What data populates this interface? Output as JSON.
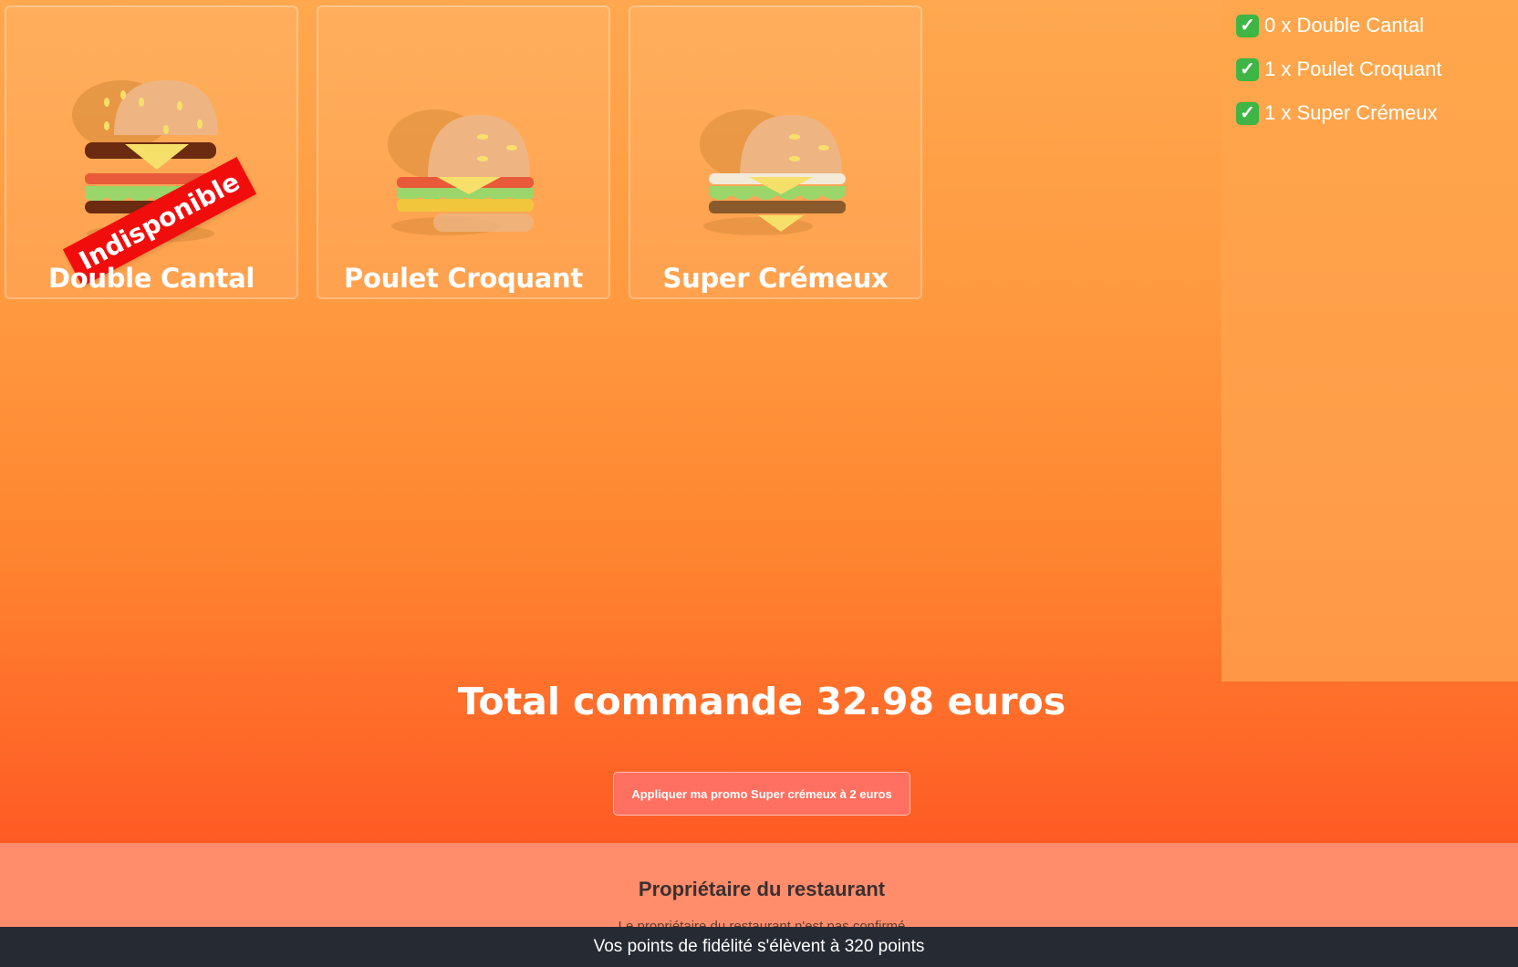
{
  "products": [
    {
      "name": "Double Cantal",
      "badge": "Indisponible",
      "icon": "double-burger-icon"
    },
    {
      "name": "Poulet Croquant",
      "icon": "chicken-burger-icon"
    },
    {
      "name": "Super Crémeux",
      "icon": "creamy-burger-icon"
    }
  ],
  "order": {
    "lines": [
      {
        "icon": "check-mark-icon",
        "text": "0 x Double Cantal"
      },
      {
        "icon": "check-mark-icon",
        "text": "1 x Poulet Croquant"
      },
      {
        "icon": "check-mark-icon",
        "text": "1 x Super Crémeux"
      }
    ]
  },
  "total": "Total commande 32.98 euros",
  "promo_button": "Appliquer ma promo Super crémeux à 2 euros",
  "owner": {
    "title": "Propriétaire du restaurant",
    "subtitle": "Le propriétaire du restaurant n'est pas confirmé"
  },
  "footer": "Vos points de fidélité s'élèvent à 320 points",
  "colors": {
    "background_top": "#ffa84f",
    "background_bottom": "#ff5a24",
    "badge": "#f20d0d",
    "promo_button": "#ff7060",
    "owner_band": "#ff8c6b",
    "footer": "#262a33"
  }
}
